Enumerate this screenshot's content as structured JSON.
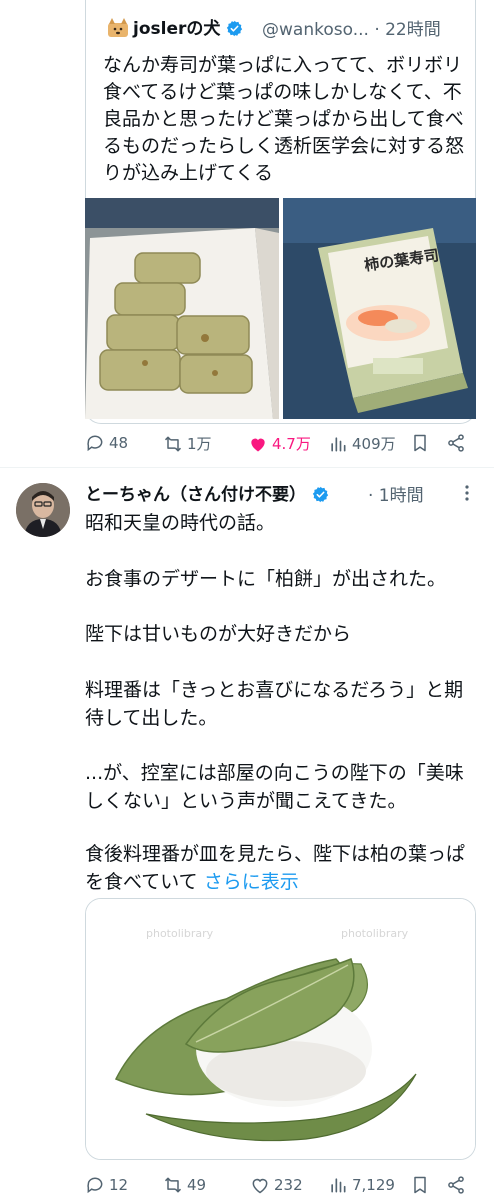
{
  "quoted_tweet": {
    "author_name": "joslerの犬",
    "author_handle": "@wankoso...",
    "time": "· 22時間",
    "text": "なんか寿司が葉っぱに入ってて、ボリボリ食べてるけど葉っぱの味しかしなくて、不良品かと思ったけど葉っぱから出して食べるものだったらしく透析医学会に対する怒りが込み上げてくる",
    "replies": "48",
    "retweets": "1万",
    "likes": "4.7万",
    "views": "409万",
    "product_label": "柿の葉寿司"
  },
  "tweet": {
    "author_name": "とーちゃん（さん付け不要）",
    "time": "· 1時間",
    "paragraphs": [
      "昭和天皇の時代の話。",
      "お食事のデザートに「柏餅」が出された。",
      "陛下は甘いものが大好きだから",
      "料理番は「きっとお喜びになるだろう」と期待して出した。",
      "...が、控室には部屋の向こうの陛下の「美味しくない」という声が聞こえてきた。",
      "食後料理番が皿を見たら、陛下は柏の葉っぱを食べていて "
    ],
    "show_more": "さらに表示",
    "watermark": "photolibrary",
    "replies": "12",
    "retweets": "49",
    "likes": "232",
    "views": "7,129"
  },
  "colors": {
    "like_active": "#f91880",
    "link": "#1d9bf0",
    "muted": "#536471",
    "verified": "#1d9bf0"
  }
}
